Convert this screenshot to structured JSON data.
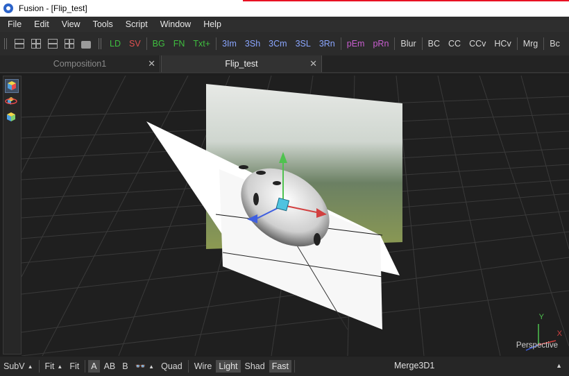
{
  "window": {
    "title": "Fusion - [Flip_test]"
  },
  "menu": [
    "File",
    "Edit",
    "View",
    "Tools",
    "Script",
    "Window",
    "Help"
  ],
  "toolbar": {
    "layout_icons": [
      "layout-single-icon",
      "layout-quad-icon",
      "layout-split-icon",
      "layout-grid-icon",
      "print-icon"
    ],
    "tools": [
      {
        "label": "LD",
        "color": "#3fbf3f"
      },
      {
        "label": "SV",
        "color": "#e05050"
      },
      {
        "label": "BG",
        "color": "#3fbf3f"
      },
      {
        "label": "FN",
        "color": "#3fbf3f"
      },
      {
        "label": "Txt+",
        "color": "#3fbf3f"
      },
      {
        "label": "3Im",
        "color": "#8aa6ff"
      },
      {
        "label": "3Sh",
        "color": "#8aa6ff"
      },
      {
        "label": "3Cm",
        "color": "#8aa6ff"
      },
      {
        "label": "3SL",
        "color": "#8aa6ff"
      },
      {
        "label": "3Rn",
        "color": "#8aa6ff"
      },
      {
        "label": "pEm",
        "color": "#c95ed0"
      },
      {
        "label": "pRn",
        "color": "#c95ed0"
      },
      {
        "label": "Blur",
        "color": "#d8d8d8"
      },
      {
        "label": "BC",
        "color": "#d8d8d8"
      },
      {
        "label": "CC",
        "color": "#d8d8d8"
      },
      {
        "label": "CCv",
        "color": "#d8d8d8"
      },
      {
        "label": "HCv",
        "color": "#d8d8d8"
      },
      {
        "label": "Mrg",
        "color": "#d8d8d8"
      },
      {
        "label": "Bc",
        "color": "#d8d8d8"
      }
    ]
  },
  "tabs": [
    {
      "label": "Composition1",
      "active": false
    },
    {
      "label": "Flip_test",
      "active": true
    }
  ],
  "viewport": {
    "view_label": "Perspective",
    "axis_y": "Y",
    "axis_x": "X",
    "colors": {
      "x_axis": "#d24040",
      "y_axis": "#4fc24f",
      "z_axis": "#3f5fe0"
    }
  },
  "statusbar": {
    "subview": "SubV",
    "fit1": "Fit",
    "fit2": "Fit",
    "a": "A",
    "ab": "AB",
    "b": "B",
    "quad": "Quad",
    "wire": "Wire",
    "light": "Light",
    "shad": "Shad",
    "fast": "Fast",
    "current_tool": "Merge3D1"
  }
}
